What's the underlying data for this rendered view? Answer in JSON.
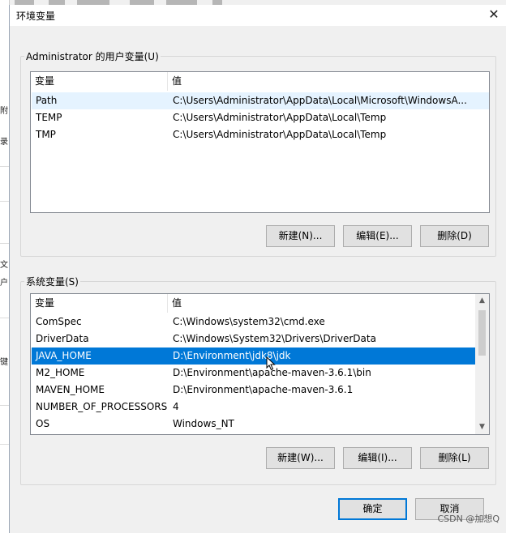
{
  "window": {
    "title": "环境变量"
  },
  "background_fragments": [
    "附",
    "录",
    "文",
    "户",
    "键"
  ],
  "user_vars": {
    "group_label": "Administrator 的用户变量(U)",
    "columns": [
      "变量",
      "值"
    ],
    "rows": [
      {
        "name": "Path",
        "value": "C:\\Users\\Administrator\\AppData\\Local\\Microsoft\\WindowsA..."
      },
      {
        "name": "TEMP",
        "value": "C:\\Users\\Administrator\\AppData\\Local\\Temp"
      },
      {
        "name": "TMP",
        "value": "C:\\Users\\Administrator\\AppData\\Local\\Temp"
      }
    ],
    "buttons": {
      "new": "新建(N)...",
      "edit": "编辑(E)...",
      "delete": "删除(D)"
    }
  },
  "system_vars": {
    "group_label": "系统变量(S)",
    "columns": [
      "变量",
      "值"
    ],
    "rows": [
      {
        "name": "ComSpec",
        "value": "C:\\Windows\\system32\\cmd.exe"
      },
      {
        "name": "DriverData",
        "value": "C:\\Windows\\System32\\Drivers\\DriverData"
      },
      {
        "name": "JAVA_HOME",
        "value": "D:\\Environment\\jdk8\\jdk"
      },
      {
        "name": "M2_HOME",
        "value": "D:\\Environment\\apache-maven-3.6.1\\bin"
      },
      {
        "name": "MAVEN_HOME",
        "value": "D:\\Environment\\apache-maven-3.6.1"
      },
      {
        "name": "NUMBER_OF_PROCESSORS",
        "value": "4"
      },
      {
        "name": "OS",
        "value": "Windows_NT"
      }
    ],
    "selected_row": "JAVA_HOME",
    "buttons": {
      "new": "新建(W)...",
      "edit": "编辑(I)...",
      "delete": "删除(L)"
    }
  },
  "footer": {
    "ok": "确定",
    "cancel": "取消"
  },
  "watermark": "CSDN @加想Q",
  "colors": {
    "selection": "#0078d7",
    "default_button_border": "#0078d7"
  },
  "icons": {
    "close": "close-icon",
    "scroll_up": "chevron-up-icon",
    "scroll_down": "chevron-down-icon",
    "cursor": "mouse-pointer-icon"
  }
}
